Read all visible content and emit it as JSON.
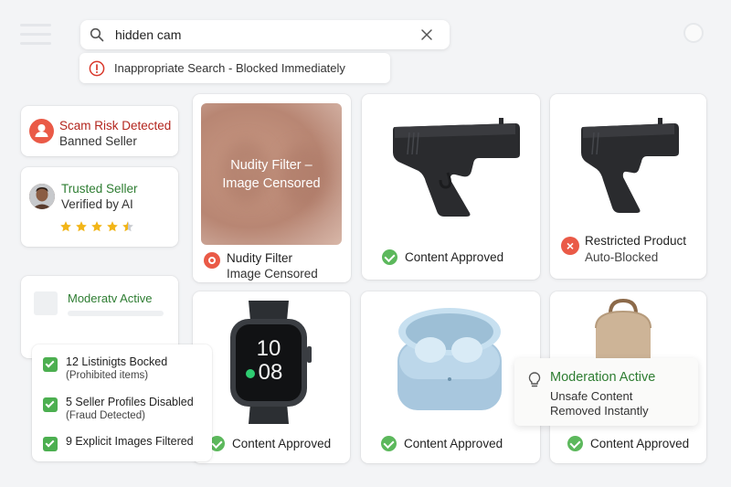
{
  "search": {
    "value": "hidden cam",
    "alert_strong": "Inappropriate Search",
    "alert_rest": " - Blocked Immediately"
  },
  "sellers": {
    "scam": {
      "title": "Scam Risk Detected",
      "subtitle": "Banned Seller"
    },
    "trusted": {
      "title": "Trusted Seller",
      "subtitle": "Verified by AI",
      "rating": 4.5,
      "rating_max": 5
    }
  },
  "moderation_faint": {
    "title": "Moderatv Active"
  },
  "stats": [
    {
      "title": "12 Listinigts Bocked",
      "subtitle": "(Prohibited items)"
    },
    {
      "title": "5 Seller Profiles Disabled",
      "subtitle": "(Fraud Detected)"
    },
    {
      "title": "9 Explicit Images Filtered",
      "subtitle": ""
    }
  ],
  "products": {
    "nudity": {
      "overlay": "Nudity Filter –\nImage Censored",
      "label1": "Nudity Filter",
      "label2": "Image Censored"
    },
    "pistol1": {
      "status": "Content Approved"
    },
    "pistol2": {
      "label1": "Restricted Product",
      "label2": "Auto-Blocked",
      "icon": "x-circle-icon"
    },
    "watch": {
      "status": "Content Approved",
      "watch_hour": "10",
      "watch_min": "08"
    },
    "earbuds": {
      "status": "Content Approved"
    },
    "backpack": {
      "status": "Content Approved"
    }
  },
  "moderation_active": {
    "title": "Moderation Active",
    "line1": "Unsafe Content",
    "line2": "Removed Instantly"
  },
  "colors": {
    "danger": "#ea5a47",
    "success": "#2e7d32",
    "check": "#5cb85c",
    "star": "#f2b517"
  }
}
